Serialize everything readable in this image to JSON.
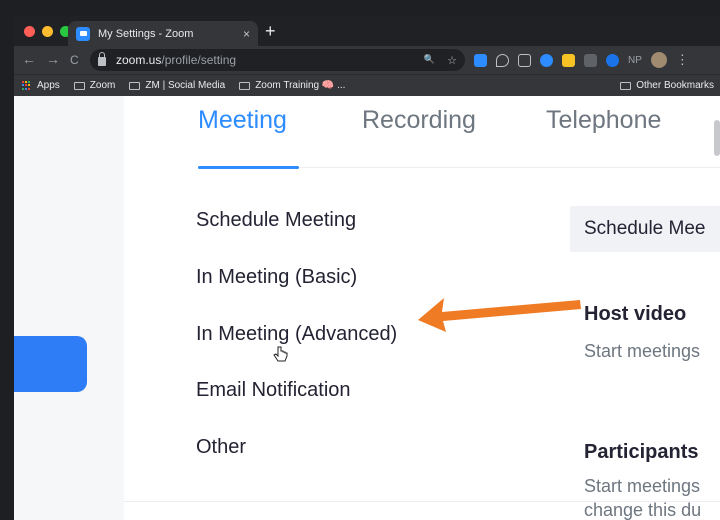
{
  "browser": {
    "tab_title": "My Settings - Zoom",
    "tab_close": "×",
    "new_tab": "+",
    "url_host": "zoom.us",
    "url_path": "/profile/setting",
    "ext_np": "NP",
    "nav_back": "←",
    "nav_forward": "→",
    "nav_reload": "C",
    "zoom_glyph": "🔍",
    "star_glyph": "☆",
    "kebab": "⋮",
    "bookmarks": [
      {
        "label": "Apps"
      },
      {
        "label": "Zoom"
      },
      {
        "label": "ZM | Social Media"
      },
      {
        "label": "Zoom Training 🧠 ..."
      }
    ],
    "other_bookmarks": "Other Bookmarks",
    "colors": {
      "chrome_dark": "#202124",
      "chrome_mid": "#35363a",
      "zoom_blue": "#2d8cff",
      "arrow_orange": "#f07b25"
    }
  },
  "settings": {
    "tabs": [
      {
        "label": "Meeting"
      },
      {
        "label": "Recording"
      },
      {
        "label": "Telephone"
      }
    ],
    "menu": [
      {
        "label": "Schedule Meeting"
      },
      {
        "label": "In Meeting (Basic)"
      },
      {
        "label": "In Meeting (Advanced)"
      },
      {
        "label": "Email Notification"
      },
      {
        "label": "Other"
      }
    ],
    "right": {
      "section_header": "Schedule Mee",
      "host_video_title": "Host video",
      "host_video_desc": "Start meetings",
      "participants_title": "Participants",
      "participants_desc_1": "Start meetings",
      "participants_desc_2": "change this du"
    }
  },
  "icons": {
    "cursor": "pointer-hand-icon",
    "annotation": "orange-arrow-icon"
  }
}
